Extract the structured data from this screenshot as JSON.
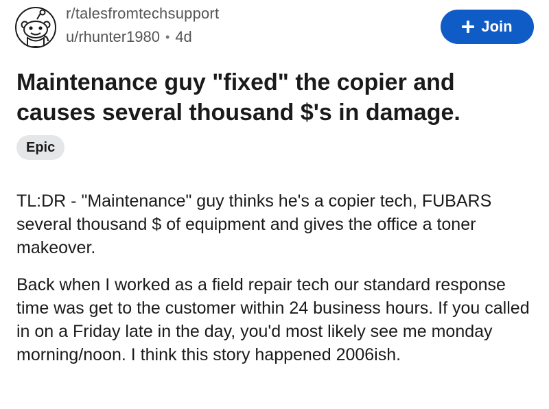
{
  "header": {
    "subreddit": "r/talesfromtechsupport",
    "username": "u/rhunter1980",
    "separator": "•",
    "age": "4d",
    "join_label": "Join",
    "avatar_icon": "reddit-snoo-icon",
    "join_icon": "plus-icon",
    "join_color": "#0f5cc7"
  },
  "post": {
    "title": "Maintenance guy \"fixed\" the copier and causes several thousand $'s in damage.",
    "flair": "Epic",
    "paragraphs": [
      "TL:DR - \"Maintenance\" guy thinks he's a copier tech, FUBARS several thousand $ of equipment and gives the office a toner makeover.",
      "Back when I worked as a field repair tech our standard response time was get to the customer within 24 business hours. If you called in on a Friday late in the day, you'd most likely see me monday morning/noon. I think this story happened 2006ish."
    ]
  }
}
